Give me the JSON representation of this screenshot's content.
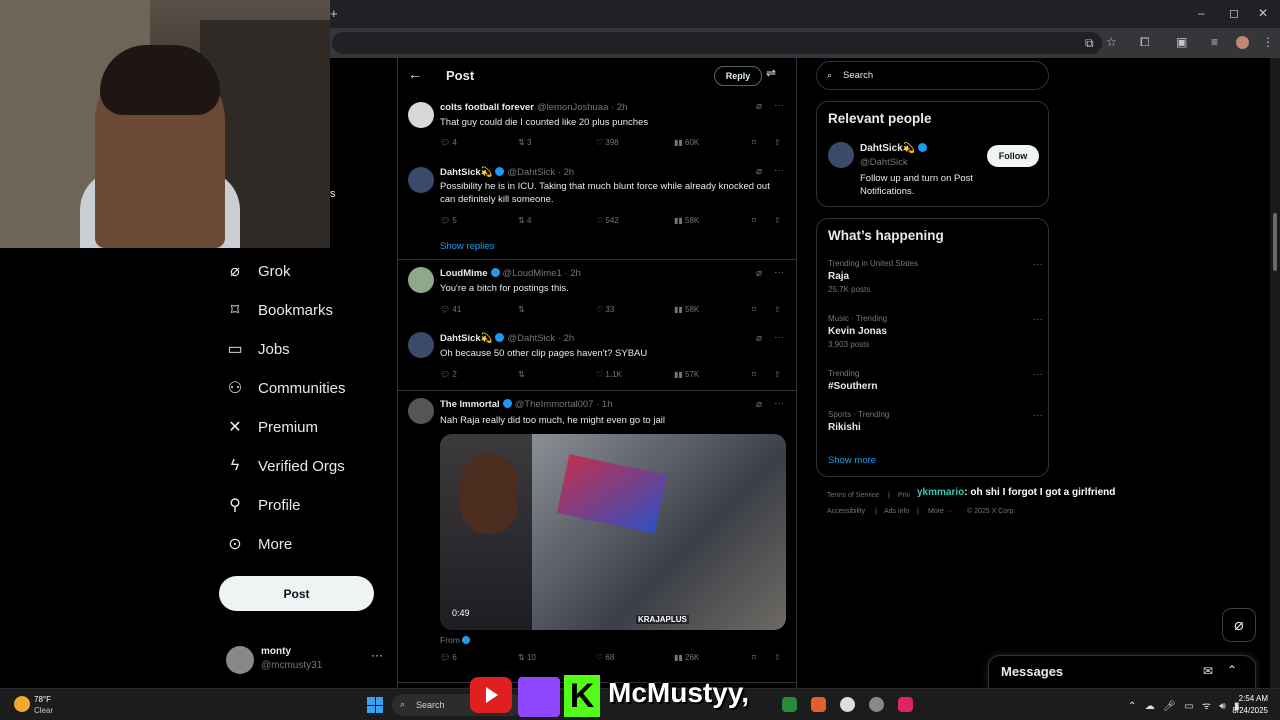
{
  "browser": {
    "new_tab": "+",
    "window_controls": [
      "–",
      "◻",
      "✕"
    ]
  },
  "sidebar": {
    "items": [
      {
        "label": "Grok",
        "icon": "grok-icon"
      },
      {
        "label": "Bookmarks",
        "icon": "bookmark-icon"
      },
      {
        "label": "Jobs",
        "icon": "briefcase-icon"
      },
      {
        "label": "Communities",
        "icon": "people-icon"
      },
      {
        "label": "Premium",
        "icon": "x-logo-icon"
      },
      {
        "label": "Verified Orgs",
        "icon": "lightning-icon"
      },
      {
        "label": "Profile",
        "icon": "person-icon"
      },
      {
        "label": "More",
        "icon": "more-circle-icon"
      }
    ],
    "post_button": "Post",
    "account": {
      "name": "monty",
      "handle": "@mcmusty31"
    },
    "cropped_letter": "s"
  },
  "main": {
    "title": "Post",
    "reply_button": "Reply",
    "tweets": [
      {
        "name": "colts football forever",
        "handle": "@lemonJoshuaa · 2h",
        "verified": false,
        "text": "That guy could die I counted like 20 plus punches",
        "replies": "4",
        "reposts": "3",
        "likes": "398",
        "views": "60K"
      },
      {
        "name": "DahtSick💫",
        "handle": "@DahtSick · 2h",
        "verified": true,
        "text": "Possibility he is in ICU. Taking that much blunt force while already knocked out can definitely kill someone.",
        "replies": "5",
        "reposts": "4",
        "likes": "542",
        "views": "58K"
      },
      {
        "name": "LoudMime",
        "handle": "@LoudMime1 · 2h",
        "verified": true,
        "text": "You're a bitch for postings this.",
        "replies": "41",
        "reposts": "",
        "likes": "33",
        "views": "58K"
      },
      {
        "name": "DahtSick💫",
        "handle": "@DahtSick · 2h",
        "verified": true,
        "text": "Oh because 50 other clip pages haven't? SYBAU",
        "replies": "2",
        "reposts": "",
        "likes": "1.1K",
        "views": "57K"
      },
      {
        "name": "The Immortal",
        "handle": "@TheImmortal007 · 1h",
        "verified": true,
        "text": "Nah Raja really did too much, he might even go to jail",
        "replies": "6",
        "reposts": "10",
        "likes": "68",
        "views": "26K"
      }
    ],
    "show_replies": "Show replies",
    "media": {
      "duration": "0:49",
      "watermark": "KRAJAPLUS"
    },
    "from_label": "From"
  },
  "right": {
    "search_placeholder": "Search",
    "relevant_people": {
      "title": "Relevant people",
      "name": "DahtSick💫",
      "handle": "@DahtSick",
      "follow_button": "Follow",
      "bio": "Follow up and turn on Post Notifications."
    },
    "whats_happening": {
      "title": "What’s happening",
      "trends": [
        {
          "category": "Trending in United States",
          "title": "Raja",
          "count": "25.7K posts"
        },
        {
          "category": "Music · Trending",
          "title": "Kevin Jonas",
          "count": "3,903 posts"
        },
        {
          "category": "Trending",
          "title": "#Southern",
          "count": ""
        },
        {
          "category": "Sports · Trending",
          "title": "Rikishi",
          "count": ""
        }
      ],
      "show_more": "Show more"
    },
    "footer": {
      "terms": "Terms of Service",
      "privacy": "Priv",
      "accessibility": "Accessibility",
      "ads_info": "Ads info",
      "more": "More ···",
      "copyright": "© 2025 X Corp."
    }
  },
  "chat_overlay": {
    "user": "ykmmario",
    "message": ": oh shi I forgot I got a girlfriend"
  },
  "messages": {
    "title": "Messages"
  },
  "taskbar": {
    "temperature": "78°F",
    "condition": "Clear",
    "search": "Search",
    "streamer_name": "McMustyy,",
    "kick_letter": "K",
    "time": "2:54 AM",
    "date": "8/24/2025"
  },
  "colors": {
    "accent": "#1d9bf0",
    "background": "#000000",
    "text": "#e7e9ea",
    "muted": "#71767b"
  }
}
